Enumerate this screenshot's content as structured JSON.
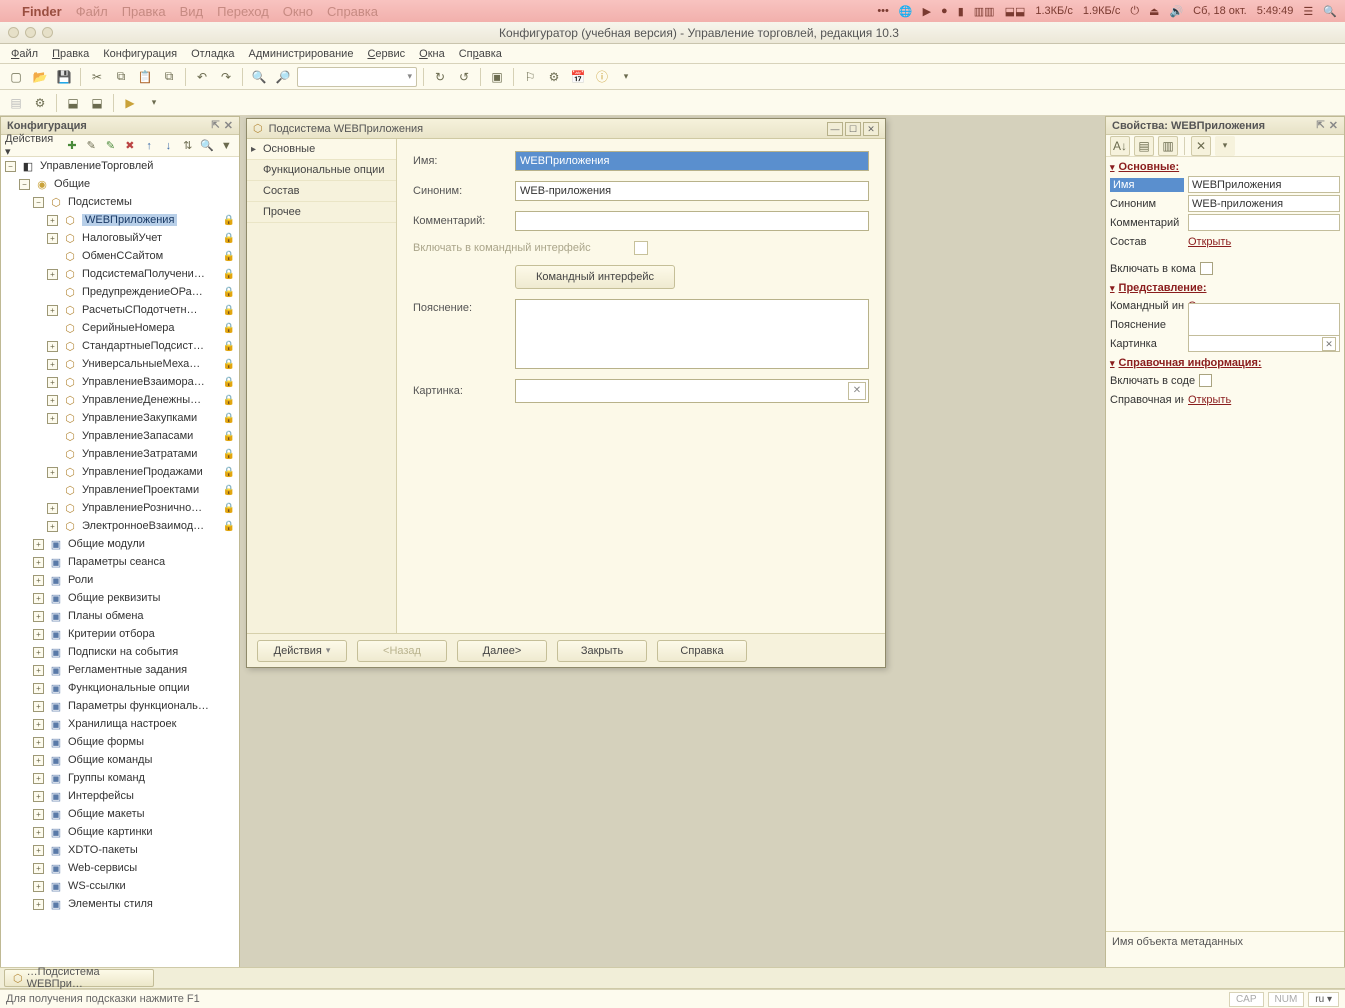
{
  "mac": {
    "apple": "",
    "app": "Finder",
    "menus": [
      "Файл",
      "Правка",
      "Вид",
      "Переход",
      "Окно",
      "Справка"
    ],
    "date": "Сб, 18 окт.",
    "time": "5:49:49",
    "net1": "1.3КБ/с",
    "net2": "1.9КБ/с"
  },
  "window": {
    "title": "Конфигуратор (учебная версия) - Управление торговлей, редакция 10.3"
  },
  "appmenu": [
    "Файл",
    "Правка",
    "Конфигурация",
    "Отладка",
    "Администрирование",
    "Сервис",
    "Окна",
    "Справка"
  ],
  "cfg_panel": {
    "title": "Конфигурация",
    "actions_label": "Действия ▾"
  },
  "tree": {
    "root": "УправлениеТорговлей",
    "common": "Общие",
    "subsystems": "Подсистемы",
    "subs": [
      "WEBПриложения",
      "НалоговыйУчет",
      "ОбменССайтом",
      "ПодсистемаПолучени…",
      "ПредупреждениеОРа…",
      "РасчетыСПодотчетн…",
      "СерийныеНомера",
      "СтандартныеПодсист…",
      "УниверсальныеМеха…",
      "УправлениеВзаимора…",
      "УправлениеДенежны…",
      "УправлениеЗакупками",
      "УправлениеЗапасами",
      "УправлениеЗатратами",
      "УправлениеПродажами",
      "УправлениеПроектами",
      "УправлениеРознично…",
      "ЭлектронноеВзаимод…"
    ],
    "rest": [
      "Общие модули",
      "Параметры сеанса",
      "Роли",
      "Общие реквизиты",
      "Планы обмена",
      "Критерии отбора",
      "Подписки на события",
      "Регламентные задания",
      "Функциональные опции",
      "Параметры функциональ…",
      "Хранилища настроек",
      "Общие формы",
      "Общие команды",
      "Группы команд",
      "Интерфейсы",
      "Общие макеты",
      "Общие картинки",
      "XDTO-пакеты",
      "Web-сервисы",
      "WS-ссылки",
      "Элементы стиля"
    ]
  },
  "modal": {
    "title": "Подсистема WEBПриложения",
    "nav": [
      "Основные",
      "Функциональные опции",
      "Состав",
      "Прочее"
    ],
    "labels": {
      "name": "Имя:",
      "syn": "Синоним:",
      "comment": "Комментарий:",
      "include": "Включать в командный интерфейс",
      "cmdbtn": "Командный интерфейс",
      "explain": "Пояснение:",
      "pic": "Картинка:"
    },
    "values": {
      "name": "WEBПриложения",
      "syn": "WEB-приложения"
    },
    "footer": {
      "actions": "Действия",
      "back": "<Назад",
      "next": "Далее>",
      "close": "Закрыть",
      "help": "Справка"
    }
  },
  "props": {
    "title": "Свойства: WEBПриложения",
    "g1": "Основные:",
    "rows1": {
      "name_l": "Имя",
      "name_v": "WEBПриложения",
      "syn_l": "Синоним",
      "syn_v": "WEB-приложения",
      "comm_l": "Комментарий",
      "sost_l": "Состав",
      "open": "Открыть",
      "incl_l": "Включать в кома"
    },
    "g2": "Представление:",
    "rows2": {
      "cmd_l": "Командный интер",
      "open": "Открыть",
      "expl_l": "Пояснение",
      "pic_l": "Картинка"
    },
    "g3": "Справочная информация:",
    "rows3": {
      "incl_l": "Включать в соде",
      "ref_l": "Справочная инф",
      "open": "Открыть"
    },
    "help": "Имя объекта метаданных"
  },
  "taskbar": {
    "item": "…Подсистема WEBПри…"
  },
  "status": {
    "hint": "Для получения подсказки нажмите F1",
    "cap": "CAP",
    "num": "NUM",
    "lang": "ru ▾"
  }
}
